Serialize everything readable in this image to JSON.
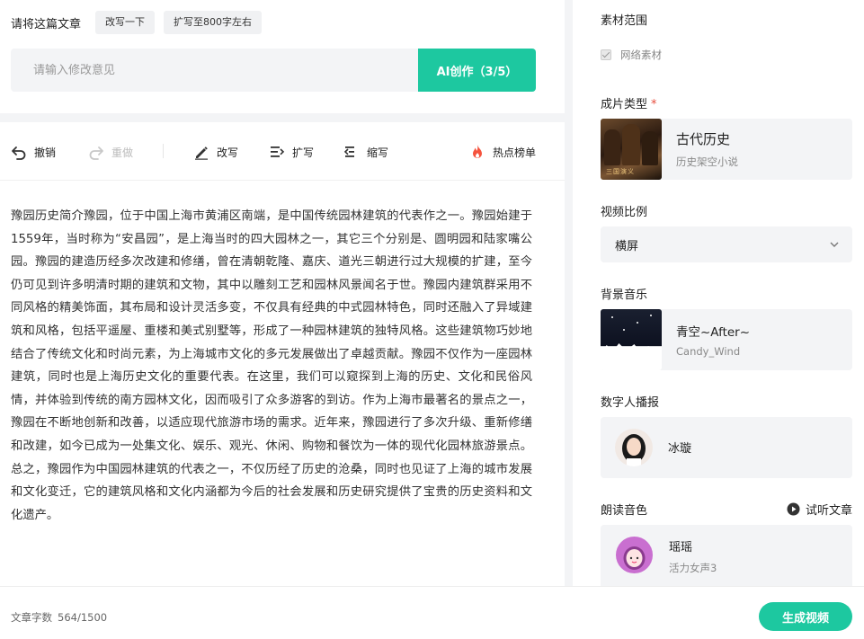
{
  "rewrite": {
    "title": "请将这篇文章",
    "chips": [
      "改写一下",
      "扩写至800字左右"
    ],
    "input_placeholder": "请输入修改意见",
    "ai_button": "AI创作（3/5）"
  },
  "toolbar": {
    "undo": "撤销",
    "redo": "重做",
    "rewrite": "改写",
    "expand": "扩写",
    "shorten": "缩写",
    "hot": "热点榜单"
  },
  "article": {
    "text": "豫园历史简介豫园，位于中国上海市黄浦区南端，是中国传统园林建筑的代表作之一。豫园始建于1559年，当时称为“安昌园”，是上海当时的四大园林之一，其它三个分别是、圆明园和陆家嘴公园。豫园的建造历经多次改建和修缮，曾在清朝乾隆、嘉庆、道光三朝进行过大规模的扩建，至今仍可见到许多明清时期的建筑和文物，其中以雕刻工艺和园林风景闻名于世。豫园内建筑群采用不同风格的精美饰面，其布局和设计灵活多变，不仅具有经典的中式园林特色，同时还融入了异域建筑和风格，包括平遥屋、重楼和美式别墅等，形成了一种园林建筑的独特风格。这些建筑物巧妙地结合了传统文化和时尚元素，为上海城市文化的多元发展做出了卓越贡献。豫园不仅作为一座园林建筑，同时也是上海历史文化的重要代表。在这里，我们可以窥探到上海的历史、文化和民俗风情，并体验到传统的南方园林文化，因而吸引了众多游客的到访。作为上海市最著名的景点之一，豫园在不断地创新和改善，以适应现代旅游市场的需求。近年来，豫园进行了多次升级、重新修缮和改建，如今已成为一处集文化、娱乐、观光、休闲、购物和餐饮为一体的现代化园林旅游景点。总之，豫园作为中国园林建筑的代表之一，不仅历经了历史的沧桑，同时也见证了上海的城市发展和文化变迁，它的建筑风格和文化内涵都为今后的社会发展和历史研究提供了宝贵的历史资料和文化遗产。"
  },
  "footer": {
    "word_count_label": "文章字数",
    "word_count_value": "564/1500",
    "generate_button": "生成视频"
  },
  "settings": {
    "material_label": "素材范围",
    "material_option": "网络素材",
    "type_label": "成片类型",
    "type_required": "*",
    "type_title": "古代历史",
    "type_sub": "历史架空小说",
    "type_thumb_caption": "三国演义",
    "ratio_label": "视频比例",
    "ratio_value": "横屏",
    "music_label": "背景音乐",
    "music_title": "青空~After~",
    "music_artist": "Candy_Wind",
    "anchor_label": "数字人播报",
    "anchor_name": "冰璇",
    "voice_label": "朗读音色",
    "preview_label": "试听文章",
    "voice_name": "瑶瑶",
    "voice_sub": "活力女声3"
  },
  "colors": {
    "accent": "#1dc8a0",
    "required": "#e74c3c",
    "hot": "#f5533d"
  }
}
